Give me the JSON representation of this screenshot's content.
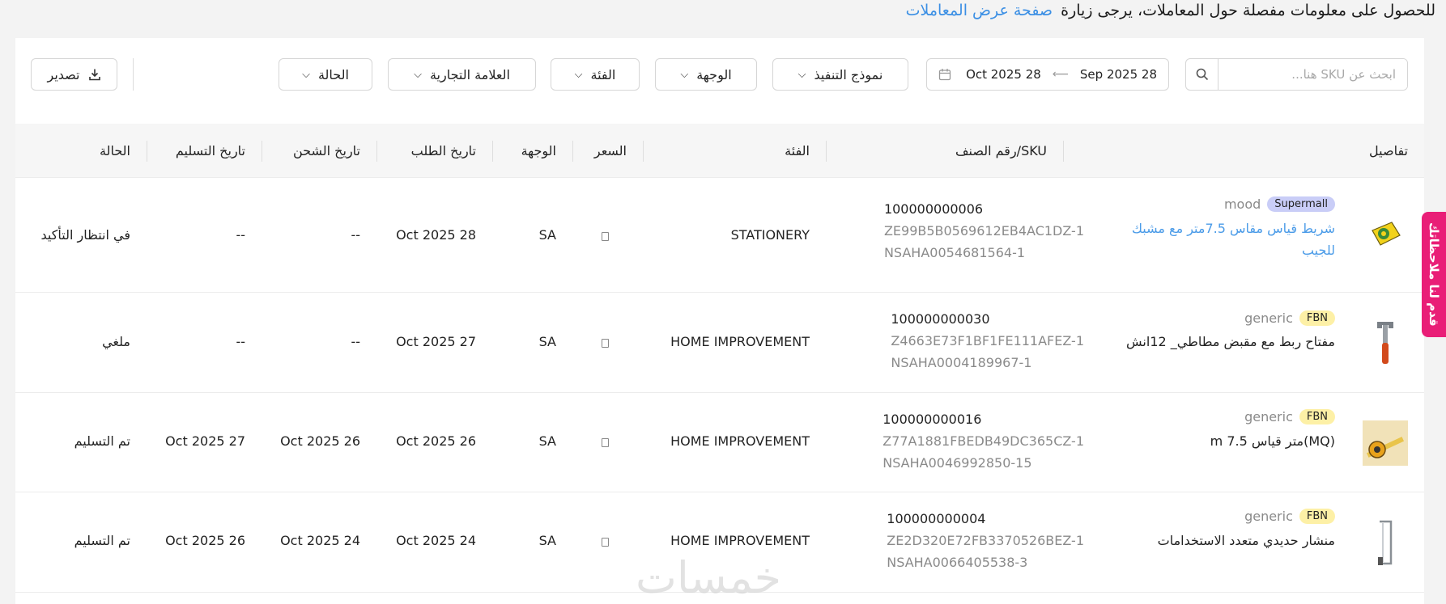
{
  "topnote": {
    "text": "للحصول على معلومات مفصلة حول المعاملات، يرجى زيارة",
    "link": "صفحة عرض المعاملات"
  },
  "filters": {
    "search_placeholder": "ابحث عن SKU هنا...",
    "date_from": "28 Sep 2025",
    "date_to": "28 Oct 2025",
    "fulfillment_model": "نموذج التنفيذ",
    "destination": "الوجهة",
    "category": "الفئة",
    "brand": "العلامة التجارية",
    "status": "الحالة",
    "export": "تصدير"
  },
  "table": {
    "headers": {
      "details": "تفاصيل",
      "sku": "SKU/رقم الصنف",
      "category": "الفئة",
      "price": "السعر",
      "destination": "الوجهة",
      "order_date": "تاريخ الطلب",
      "ship_date": "تاريخ الشحن",
      "delivery_date": "تاريخ التسليم",
      "status": "الحالة"
    },
    "rows": [
      {
        "brand": "mood",
        "badge": "Supermall",
        "name_line1": "شريط قياس مقاس 7.5متر مع مشبك",
        "name_line2": "للجيب",
        "sku1": "100000000006",
        "sku2": "ZE99B5B0569612EB4AC1DZ-1",
        "sku3": "NSAHA0054681564-1",
        "category": "STATIONERY",
        "destination": "SA",
        "order_date": "28 Oct 2025",
        "ship_date": "--",
        "delivery_date": "--",
        "status": "في انتظار التأكيد"
      },
      {
        "brand": "generic",
        "badge": "FBN",
        "name_line1": "مفتاح ربط مع مقبض مطاطي_ 12انش",
        "sku1": "100000000030",
        "sku2": "Z4663E73F1BF1FE111AFEZ-1",
        "sku3": "NSAHA0004189967-1",
        "category": "HOME IMPROVEMENT",
        "destination": "SA",
        "order_date": "27 Oct 2025",
        "ship_date": "--",
        "delivery_date": "--",
        "status": "ملغي"
      },
      {
        "brand": "generic",
        "badge": "FBN",
        "name_line1": "(MQ)متر قياس 7.5 m",
        "sku1": "100000000016",
        "sku2": "Z77A1881FBEDB49DC365CZ-1",
        "sku3": "NSAHA0046992850-15",
        "category": "HOME IMPROVEMENT",
        "destination": "SA",
        "order_date": "26 Oct 2025",
        "ship_date": "26 Oct 2025",
        "delivery_date": "27 Oct 2025",
        "status": "تم التسليم"
      },
      {
        "brand": "generic",
        "badge": "FBN",
        "name_line1": "منشار حديدي متعدد الاستخدامات",
        "sku1": "100000000004",
        "sku2": "ZE2D320E72FB3370526BEZ-1",
        "sku3": "NSAHA0066405538-3",
        "category": "HOME IMPROVEMENT",
        "destination": "SA",
        "order_date": "24 Oct 2025",
        "ship_date": "24 Oct 2025",
        "delivery_date": "26 Oct 2025",
        "status": "تم التسليم"
      }
    ]
  },
  "feedback_tab": "قدم لنا ملاحظاتك",
  "watermark": "خمسات"
}
